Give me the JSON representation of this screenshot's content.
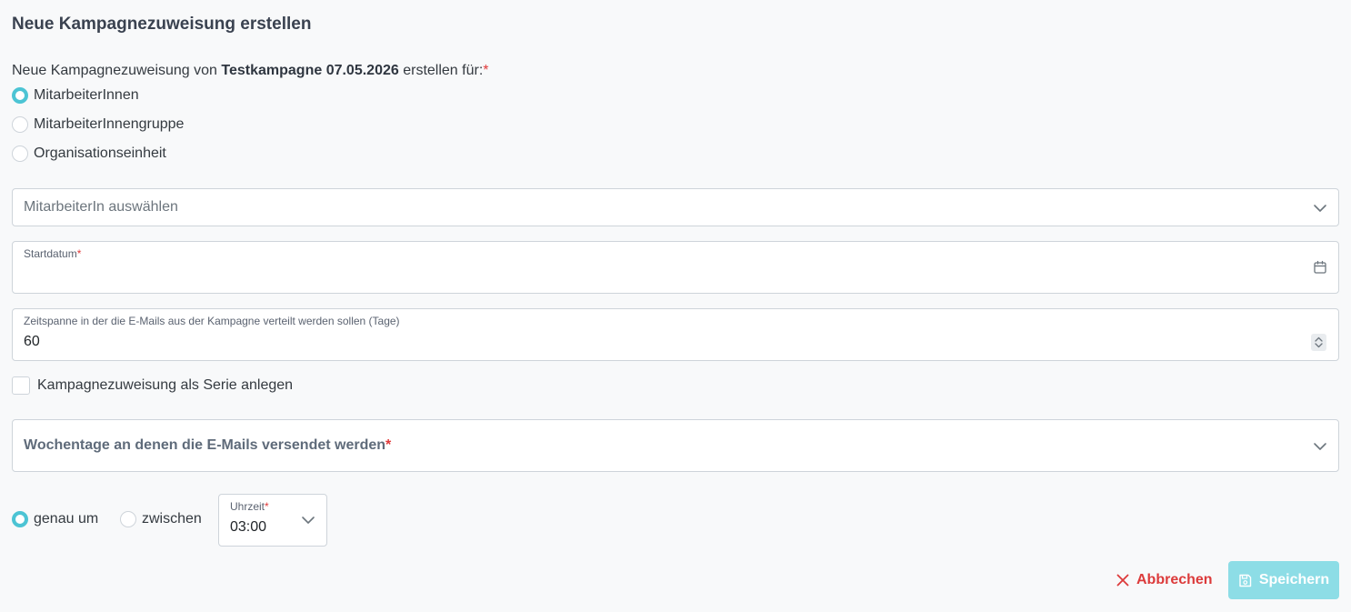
{
  "header": {
    "title": "Neue Kampagnezuweisung erstellen"
  },
  "intro": {
    "prefix": "Neue Kampagnezuweisung von",
    "campaign_name": "Testkampagne 07.05.2026",
    "suffix": "erstellen für:",
    "required_mark": "*"
  },
  "target_options": [
    {
      "label": "MitarbeiterInnen",
      "checked": true
    },
    {
      "label": "MitarbeiterInnengruppe",
      "checked": false
    },
    {
      "label": "Organisationseinheit",
      "checked": false
    }
  ],
  "employee_select": {
    "placeholder": "MitarbeiterIn auswählen",
    "icon": "chevron-down-icon"
  },
  "start_date": {
    "label": "Startdatum",
    "required_mark": "*",
    "value": "",
    "icon": "calendar-icon"
  },
  "time_span": {
    "label": "Zeitspanne in der die E-Mails aus der Kampagne verteilt werden sollen (Tage)",
    "value": "60"
  },
  "series": {
    "label": "Kampagnezuweisung als Serie anlegen",
    "checked": false
  },
  "weekdays": {
    "label": "Wochentage an denen die E-Mails versendet werden",
    "required_mark": "*",
    "icon": "chevron-down-icon"
  },
  "time_mode": {
    "options": [
      {
        "label": "genau um",
        "checked": true
      },
      {
        "label": "zwischen",
        "checked": false
      }
    ]
  },
  "time": {
    "label": "Uhrzeit",
    "required_mark": "*",
    "value": "03:00"
  },
  "actions": {
    "cancel_label": "Abbrechen",
    "save_label": "Speichern"
  },
  "colors": {
    "accent": "#4cc4d4",
    "danger": "#dc3b3b",
    "save_disabled": "#8ddde6"
  }
}
